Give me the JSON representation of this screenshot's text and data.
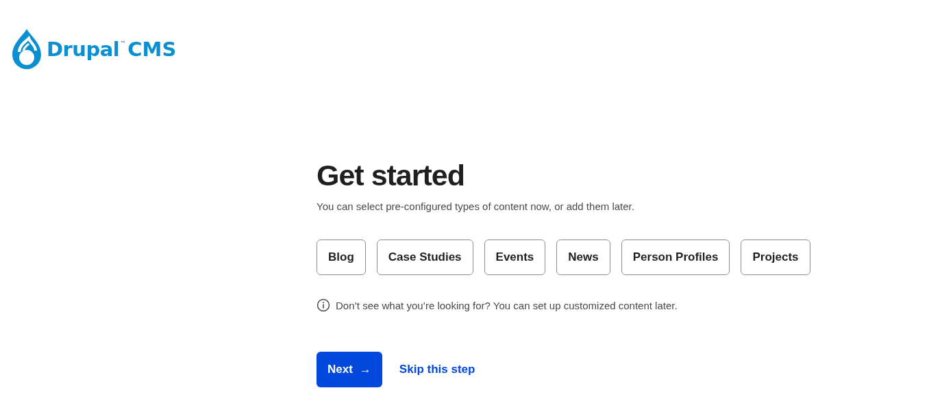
{
  "logo": {
    "name": "Drupal",
    "mark": "™",
    "product": "CMS"
  },
  "title": "Get started",
  "subtitle": "You can select pre-configured types of content now, or add them later.",
  "options": [
    {
      "label": "Blog",
      "selected": false
    },
    {
      "label": "Case Studies",
      "selected": false
    },
    {
      "label": "Events",
      "selected": false
    },
    {
      "label": "News",
      "selected": false
    },
    {
      "label": "Person Profiles",
      "selected": false
    },
    {
      "label": "Projects",
      "selected": false
    }
  ],
  "hint": "Don’t see what you’re looking for? You can set up customized content later.",
  "next_button": {
    "label": "Next",
    "arrow": "→"
  },
  "skip_link": "Skip this step"
}
